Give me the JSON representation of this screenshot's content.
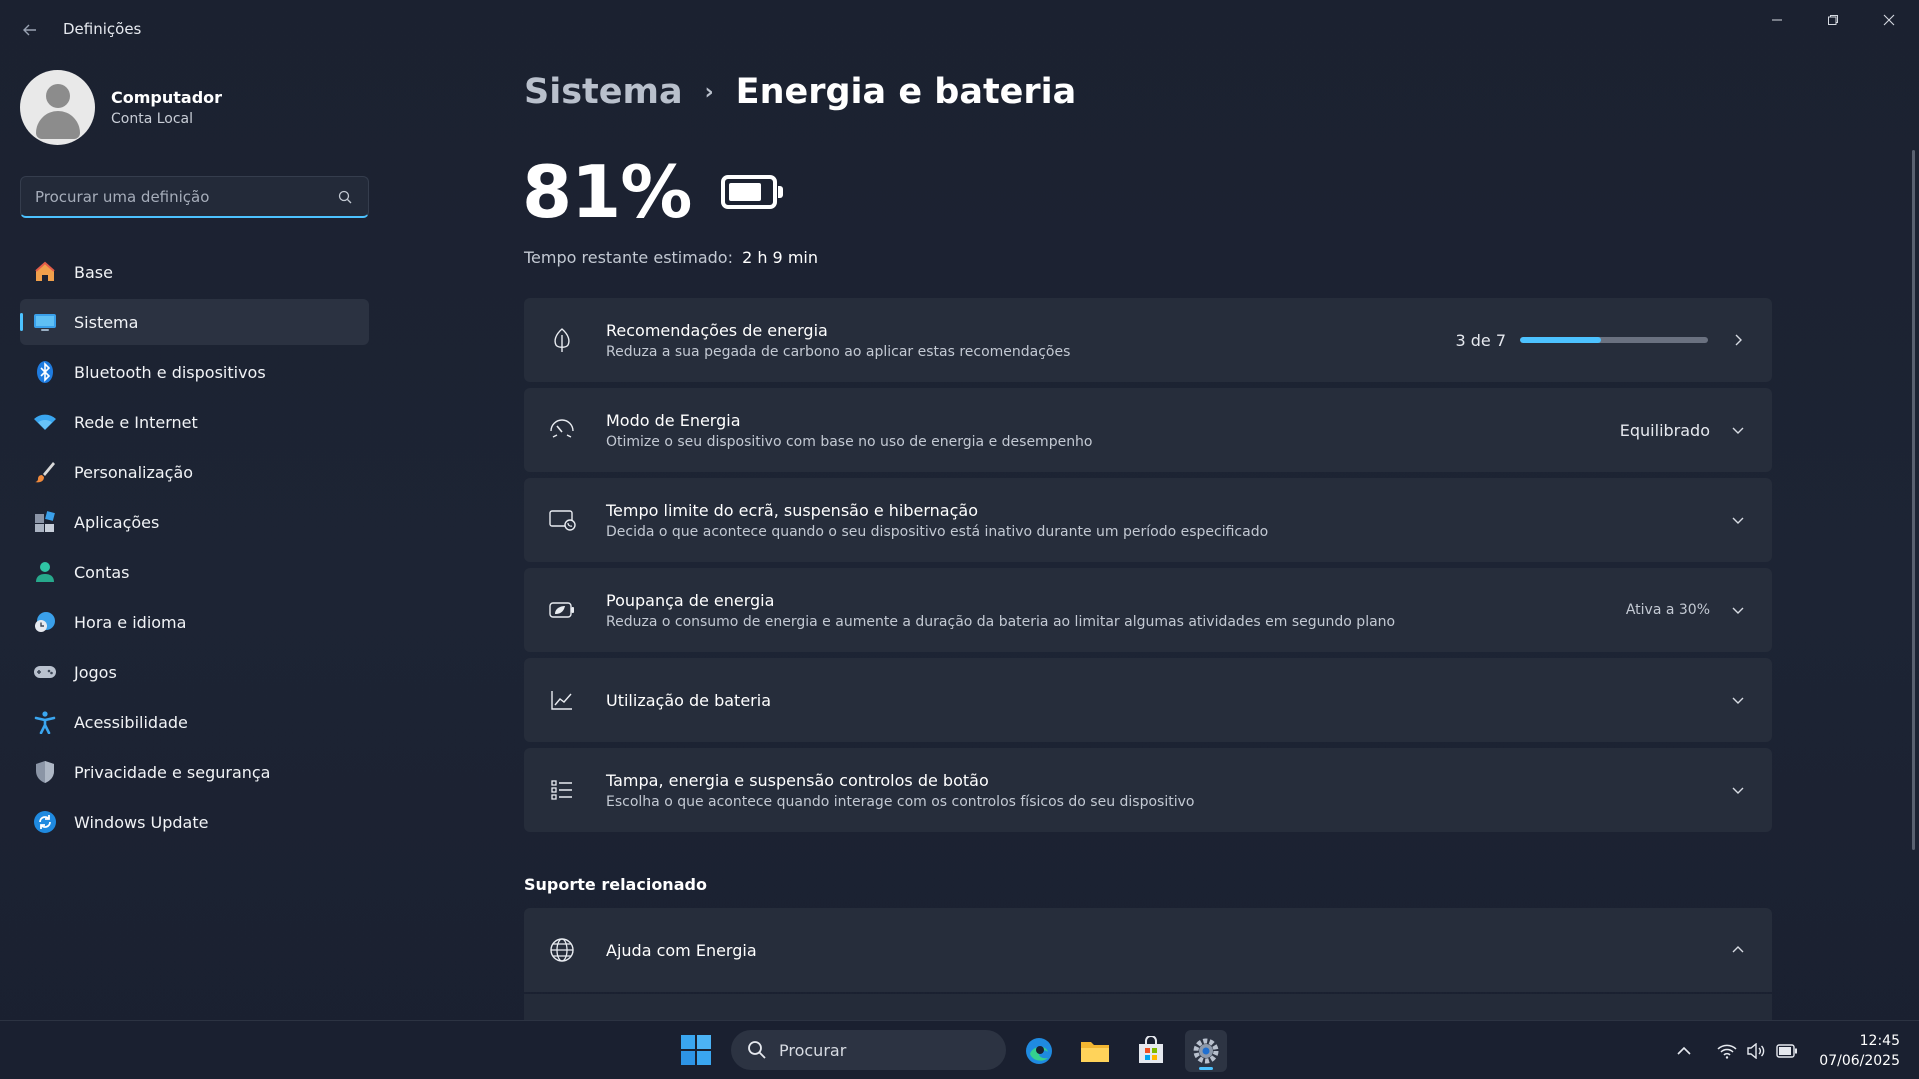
{
  "window": {
    "title": "Definições"
  },
  "profile": {
    "name": "Computador",
    "account": "Conta Local"
  },
  "search": {
    "placeholder": "Procurar uma definição"
  },
  "sidebar": {
    "items": [
      {
        "label": "Base",
        "icon": "home-icon"
      },
      {
        "label": "Sistema",
        "icon": "system-icon",
        "active": true
      },
      {
        "label": "Bluetooth e dispositivos",
        "icon": "bluetooth-icon"
      },
      {
        "label": "Rede e Internet",
        "icon": "wifi-icon"
      },
      {
        "label": "Personalização",
        "icon": "brush-icon"
      },
      {
        "label": "Aplicações",
        "icon": "apps-icon"
      },
      {
        "label": "Contas",
        "icon": "account-icon"
      },
      {
        "label": "Hora e idioma",
        "icon": "clock-globe-icon"
      },
      {
        "label": "Jogos",
        "icon": "gamepad-icon"
      },
      {
        "label": "Acessibilidade",
        "icon": "accessibility-icon"
      },
      {
        "label": "Privacidade e segurança",
        "icon": "shield-icon"
      },
      {
        "label": "Windows Update",
        "icon": "update-icon"
      }
    ]
  },
  "breadcrumb": {
    "parent": "Sistema",
    "separator": "›",
    "current": "Energia e bateria"
  },
  "battery": {
    "percent_text": "81%",
    "level": 0.81,
    "remaining_label": "Tempo restante estimado:",
    "remaining_value": "2 h 9 min"
  },
  "cards": [
    {
      "title": "Recomendações de energia",
      "subtitle": "Reduza a sua pegada de carbono ao aplicar estas recomendações",
      "value": "3 de 7",
      "progress": 0.43,
      "icon": "leaf-icon",
      "action": "chevron-right-icon"
    },
    {
      "title": "Modo de Energia",
      "subtitle": "Otimize o seu dispositivo com base no uso de energia e desempenho",
      "value": "Equilibrado",
      "icon": "power-mode-icon",
      "action": "chevron-down-icon"
    },
    {
      "title": "Tempo limite do ecrã, suspensão e hibernação",
      "subtitle": "Decida o que acontece quando o seu dispositivo está inativo durante um período especificado",
      "value": "",
      "icon": "screen-sleep-icon",
      "action": "chevron-down-icon"
    },
    {
      "title": "Poupança de energia",
      "subtitle": "Reduza o consumo de energia e aumente a duração da bateria ao limitar algumas atividades em segundo plano",
      "value": "Ativa a 30%",
      "icon": "battery-saver-icon",
      "action": "chevron-down-icon"
    },
    {
      "title": "Utilização de bateria",
      "subtitle": "",
      "value": "",
      "icon": "chart-line-icon",
      "action": "chevron-down-icon"
    },
    {
      "title": "Tampa, energia e suspensão controlos de botão",
      "subtitle": "Escolha o que acontece quando interage com os controlos físicos do seu dispositivo",
      "value": "",
      "icon": "list-controls-icon",
      "action": "chevron-down-icon"
    }
  ],
  "support": {
    "section_title": "Suporte relacionado",
    "item_title": "Ajuda com Energia",
    "icon": "globe-icon",
    "action": "chevron-up-icon"
  },
  "taskbar": {
    "search_label": "Procurar",
    "time": "12:45",
    "date": "07/06/2025"
  },
  "colors": {
    "accent": "#4cc2ff",
    "background": "#1c2231",
    "card": "#262d3b"
  }
}
